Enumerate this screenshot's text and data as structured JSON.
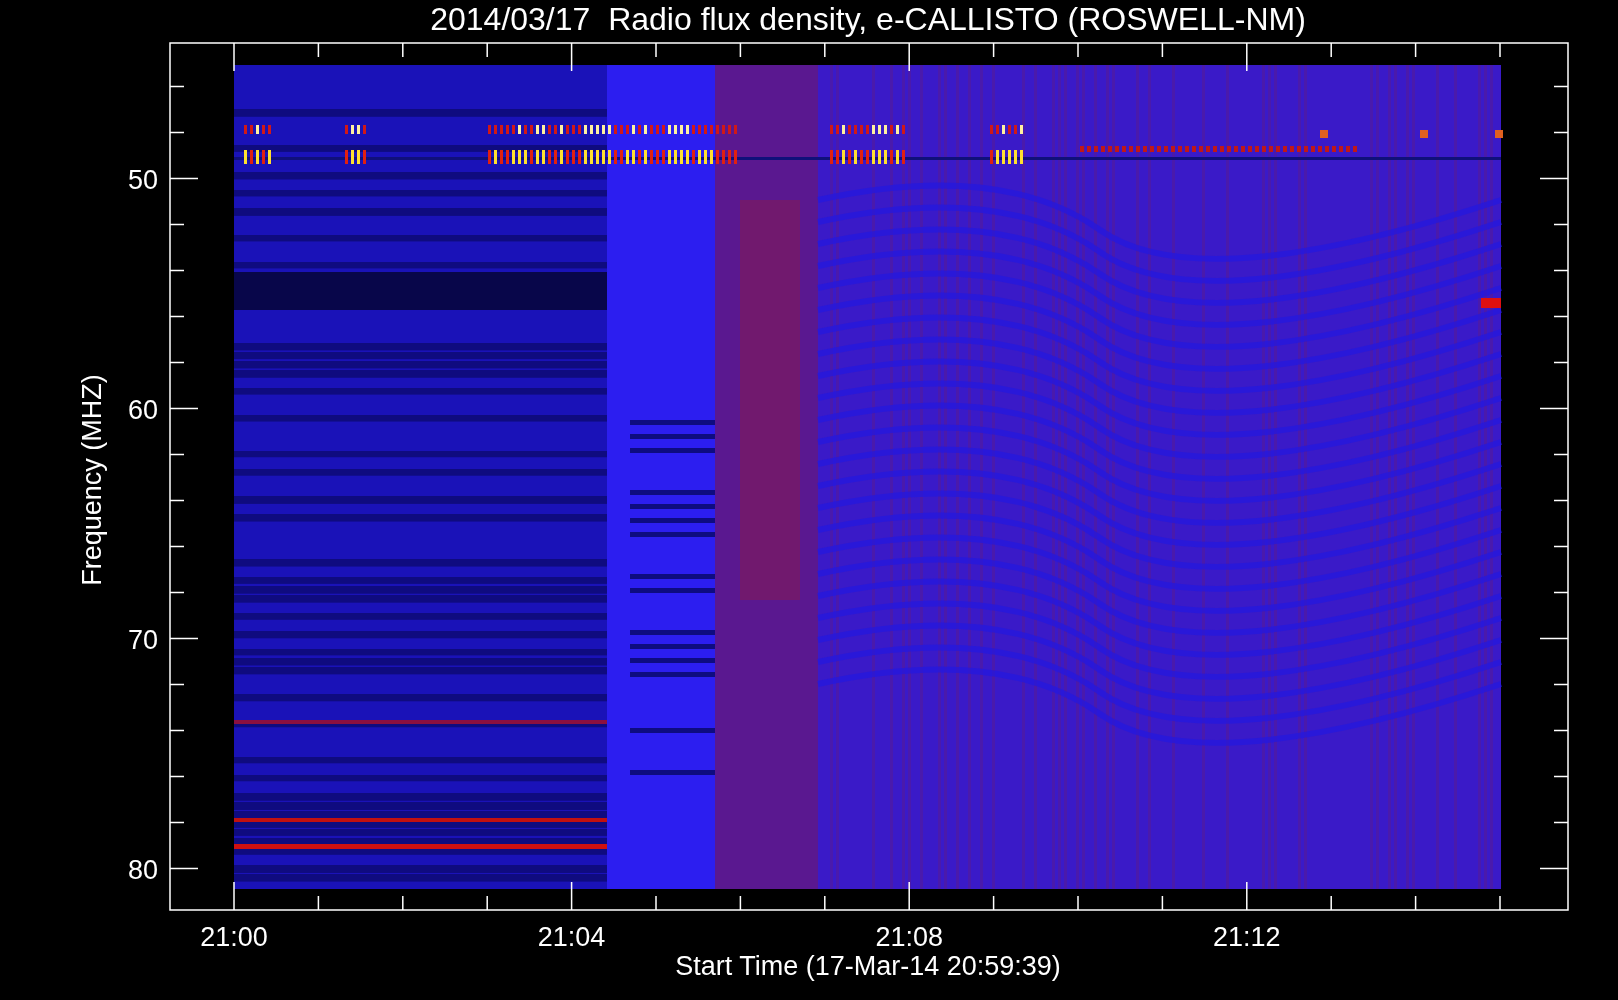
{
  "title": "2014/03/17  Radio flux density, e-CALLISTO (ROSWELL-NM)",
  "y_axis": {
    "label": "Frequency (MHZ)",
    "ticks": [
      "50",
      "60",
      "70",
      "80"
    ]
  },
  "x_axis": {
    "label": "Start Time (17-Mar-14 20:59:39)",
    "ticks": [
      "21:00",
      "21:04",
      "21:08",
      "21:12"
    ]
  }
}
